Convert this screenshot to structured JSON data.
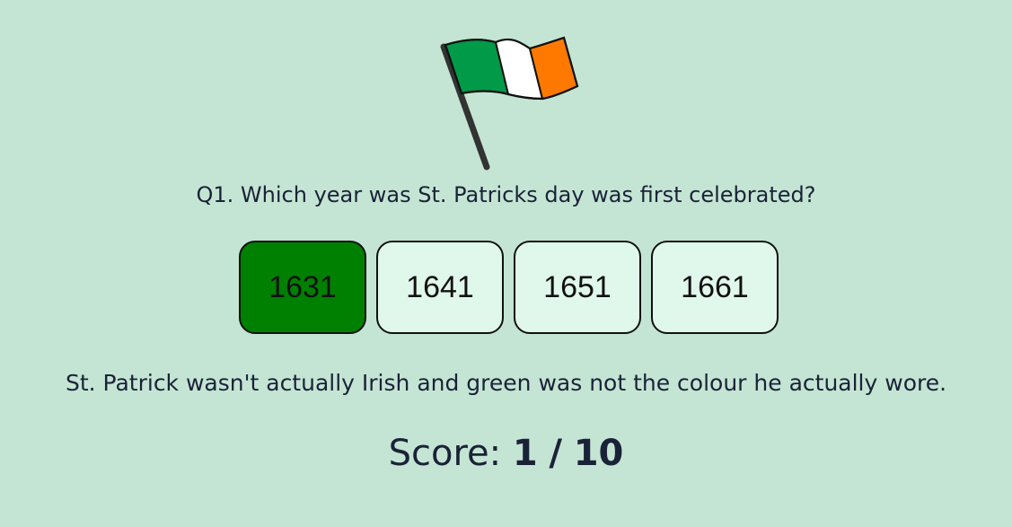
{
  "question": {
    "text": "Q1. Which year was St. Patricks day was first celebrated?"
  },
  "answers": [
    {
      "label": "1631",
      "state": "correct"
    },
    {
      "label": "1641",
      "state": "default"
    },
    {
      "label": "1651",
      "state": "default"
    },
    {
      "label": "1661",
      "state": "default"
    }
  ],
  "fact": {
    "text": "St. Patrick wasn't actually Irish and green was not the colour he actually wore."
  },
  "score": {
    "label": "Score:",
    "current": "1",
    "separator": "/",
    "total": "10"
  },
  "icons": {
    "flag": "irish-flag-icon"
  },
  "colors": {
    "background": "#c4e5d3",
    "correct_answer": "#008000",
    "answer_default": "#e0f8ec",
    "flag_green": "#009a49",
    "flag_white": "#ffffff",
    "flag_orange": "#ff7900"
  }
}
